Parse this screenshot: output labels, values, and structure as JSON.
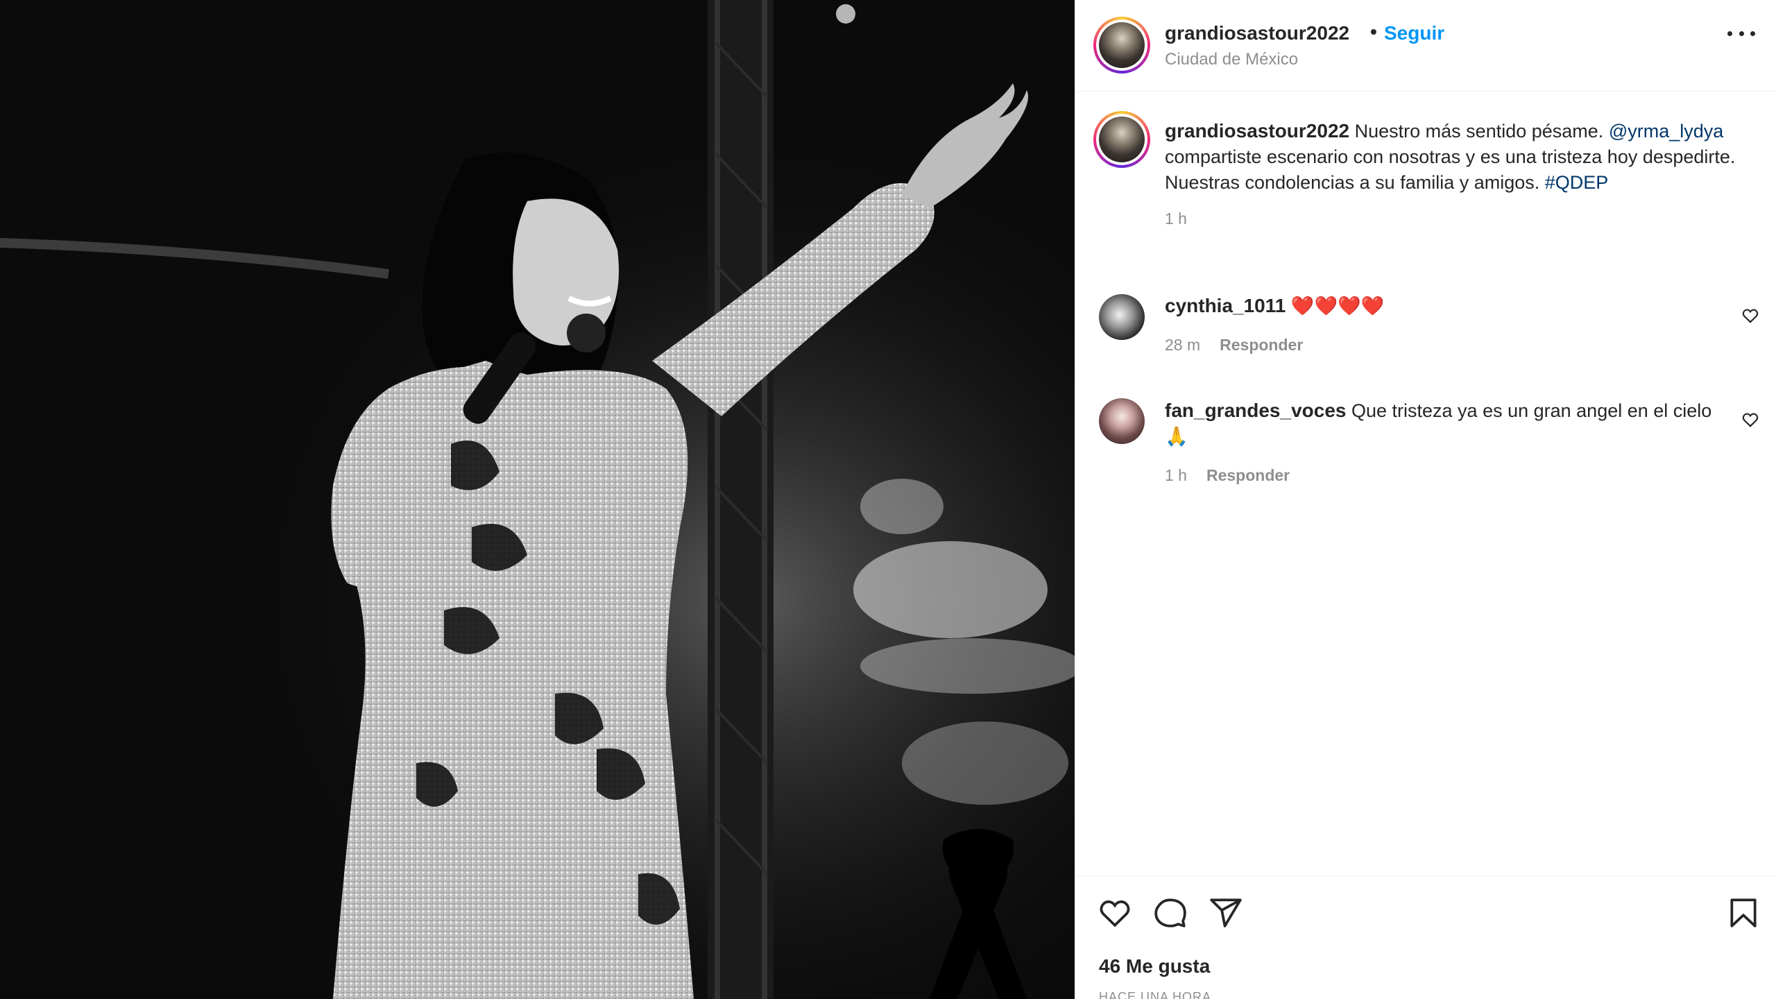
{
  "post": {
    "username": "grandiosastour2022",
    "separator": "•",
    "follow_label": "Seguir",
    "location": "Ciudad de México",
    "more_icon": "more-horizontal-icon"
  },
  "caption": {
    "username": "grandiosastour2022",
    "text_part1": "Nuestro más sentido pésame.",
    "mention": "@yrma_lydya",
    "text_part2": "compartiste escenario con nosotras y es una tristeza hoy despedirte. Nuestras condolencias a su familia y amigos.",
    "hashtag": "#QDEP",
    "time": "1 h"
  },
  "comments": [
    {
      "username": "cynthia_1011",
      "text": "❤️❤️❤️❤️",
      "time": "28 m",
      "reply_label": "Responder"
    },
    {
      "username": "fan_grandes_voces",
      "text": "Que tristeza ya es un gran angel en el cielo 🙏",
      "time": "1 h",
      "reply_label": "Responder"
    }
  ],
  "actions": {
    "like_icon": "heart-icon",
    "comment_icon": "comment-icon",
    "share_icon": "send-icon",
    "save_icon": "bookmark-icon"
  },
  "likes_text": "46 Me gusta",
  "time_ago": "HACE UNA HORA",
  "colors": {
    "link_blue": "#0095f6",
    "mention_blue": "#00376b",
    "muted_gray": "#8e8e8e",
    "text_dark": "#262626"
  }
}
